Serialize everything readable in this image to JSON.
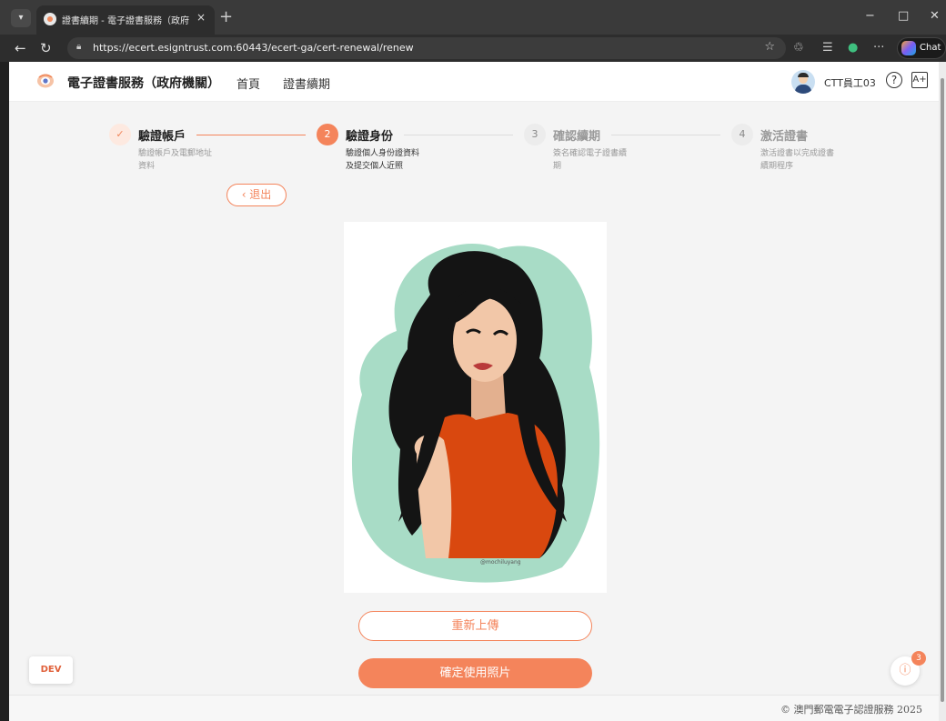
{
  "browser": {
    "tab_title": "證書續期 - 電子證書服務（政府機",
    "tab_close": "×",
    "new_tab": "+",
    "url": "https://ecert.esigntrust.com:60443/ecert-ga/cert-renewal/renew",
    "chat_label": "Chat",
    "window_minimize": "−",
    "window_maximize": "□",
    "window_close": "✕",
    "more": "···"
  },
  "header": {
    "brand": "電子證書服務（政府機關）",
    "nav": [
      "首頁",
      "證書續期"
    ],
    "user_name": "CTT員工03",
    "help_icon": "?",
    "account_icon": "A+"
  },
  "steps": [
    {
      "number": "✓",
      "title": "驗證帳戶",
      "desc_line1": "驗證帳戶及電郵地址",
      "desc_line2": "資料",
      "state": "done"
    },
    {
      "number": "2",
      "title": "驗證身份",
      "desc_line1": "驗證個人身份證資料",
      "desc_line2": "及提交個人近照",
      "state": "active"
    },
    {
      "number": "3",
      "title": "確認續期",
      "desc_line1": "簽名確認電子證書續",
      "desc_line2": "期",
      "state": "pending"
    },
    {
      "number": "4",
      "title": "激活證書",
      "desc_line1": "激活證書以完成證書",
      "desc_line2": "續期程序",
      "state": "pending"
    }
  ],
  "exit_button": "‹ 退出",
  "photo": {
    "signature": "@mochiluyang",
    "colors": {
      "background": "#a8dcc6",
      "hair": "#141414",
      "skin": "#f2c7a8",
      "top": "#d9480f"
    }
  },
  "actions": {
    "reupload": "重新上傳",
    "confirm": "確定使用照片"
  },
  "dev_badge": "DEV",
  "info_button": {
    "icon": "ⓘ",
    "count": "3"
  },
  "footer": {
    "copyright": "© 澳門郵電電子認證服務 2025"
  },
  "theme": {
    "accent": "#f4845b"
  }
}
